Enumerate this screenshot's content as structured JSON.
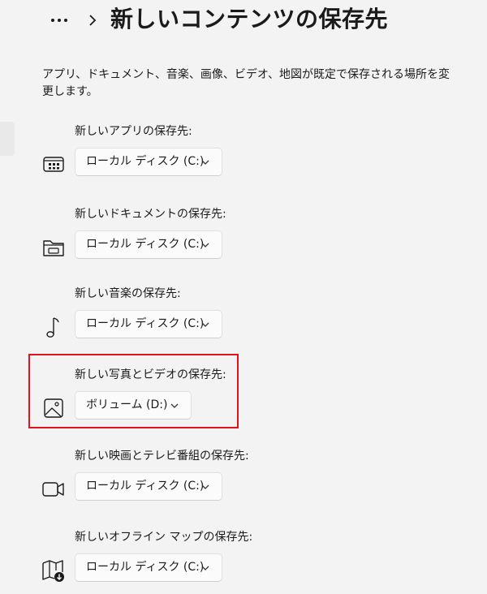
{
  "header": {
    "more_icon": "more-horizontal-icon",
    "separator_icon": "chevron-right-icon",
    "title": "新しいコンテンツの保存先"
  },
  "description": "アプリ、ドキュメント、音楽、画像、ビデオ、地図が既定で保存される場所を変更します。",
  "settings": [
    {
      "label": "新しいアプリの保存先:",
      "value": "ローカル ディスク (C:)",
      "icon": "app-icon"
    },
    {
      "label": "新しいドキュメントの保存先:",
      "value": "ローカル ディスク (C:)",
      "icon": "folder-document-icon"
    },
    {
      "label": "新しい音楽の保存先:",
      "value": "ローカル ディスク (C:)",
      "icon": "music-note-icon"
    },
    {
      "label": "新しい写真とビデオの保存先:",
      "value": "ボリューム (D:)",
      "icon": "photo-icon",
      "highlighted": true
    },
    {
      "label": "新しい映画とテレビ番組の保存先:",
      "value": "ローカル ディスク (C:)",
      "icon": "video-camera-icon"
    },
    {
      "label": "新しいオフライン マップの保存先:",
      "value": "ローカル ディスク (C:)",
      "icon": "offline-map-icon"
    }
  ],
  "colors": {
    "background": "#f3f3f3",
    "highlight": "#e0121d",
    "dropdown_bg": "#fbfbfb"
  }
}
